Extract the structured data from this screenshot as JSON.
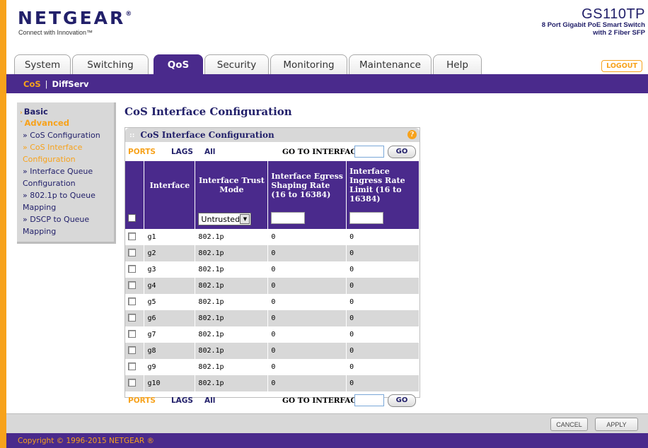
{
  "brand": {
    "logo": "NETGEAR",
    "logo_mark": "®",
    "tagline": "Connect with Innovation™"
  },
  "model": {
    "name": "GS110TP",
    "desc_line1": "8 Port Gigabit PoE Smart Switch",
    "desc_line2": "with 2 Fiber SFP"
  },
  "tabs": [
    {
      "label": "System",
      "active": false
    },
    {
      "label": "Switching",
      "active": false
    },
    {
      "label": "QoS",
      "active": true
    },
    {
      "label": "Security",
      "active": false
    },
    {
      "label": "Monitoring",
      "active": false
    },
    {
      "label": "Maintenance",
      "active": false
    },
    {
      "label": "Help",
      "active": false
    }
  ],
  "logout_label": "LOGOUT",
  "subnav": {
    "items": [
      "CoS",
      "DiffServ"
    ],
    "separator": "|",
    "active": "CoS"
  },
  "leftnav": {
    "basic": "Basic",
    "advanced": "Advanced",
    "sub_items": [
      {
        "label": "» CoS Configuration",
        "active": false
      },
      {
        "label": "» CoS Interface Configuration",
        "active": true
      },
      {
        "label": "» Interface Queue Configuration",
        "active": false
      },
      {
        "label": "» 802.1p to Queue Mapping",
        "active": false
      },
      {
        "label": "» DSCP to Queue Mapping",
        "active": false
      }
    ]
  },
  "page_title": "CoS Interface Configuration",
  "panel": {
    "title": "CoS Interface Configuration",
    "help": "?",
    "filter": {
      "ports": "PORTS",
      "lags": "LAGS",
      "all": "All",
      "goto": "GO TO INTERFACE",
      "go": "GO"
    },
    "columns": [
      "Interface",
      "Interface Trust Mode",
      "Interface Egress Shaping Rate (16 to 16384)",
      "Interface Ingress Rate Limit (16 to 16384)"
    ],
    "edit_row": {
      "trust_mode": "Untrusted"
    },
    "rows": [
      {
        "interface": "g1",
        "trust": "802.1p",
        "egress": "0",
        "ingress": "0"
      },
      {
        "interface": "g2",
        "trust": "802.1p",
        "egress": "0",
        "ingress": "0"
      },
      {
        "interface": "g3",
        "trust": "802.1p",
        "egress": "0",
        "ingress": "0"
      },
      {
        "interface": "g4",
        "trust": "802.1p",
        "egress": "0",
        "ingress": "0"
      },
      {
        "interface": "g5",
        "trust": "802.1p",
        "egress": "0",
        "ingress": "0"
      },
      {
        "interface": "g6",
        "trust": "802.1p",
        "egress": "0",
        "ingress": "0"
      },
      {
        "interface": "g7",
        "trust": "802.1p",
        "egress": "0",
        "ingress": "0"
      },
      {
        "interface": "g8",
        "trust": "802.1p",
        "egress": "0",
        "ingress": "0"
      },
      {
        "interface": "g9",
        "trust": "802.1p",
        "egress": "0",
        "ingress": "0"
      },
      {
        "interface": "g10",
        "trust": "802.1p",
        "egress": "0",
        "ingress": "0"
      }
    ]
  },
  "actions": {
    "cancel": "CANCEL",
    "apply": "APPLY"
  },
  "footer": "Copyright © 1996-2015 NETGEAR ®",
  "colors": {
    "brand_purple": "#4a2a8c",
    "brand_orange": "#f7a21b",
    "navy_text": "#22206a",
    "panel_gray": "#d8d8d8"
  }
}
